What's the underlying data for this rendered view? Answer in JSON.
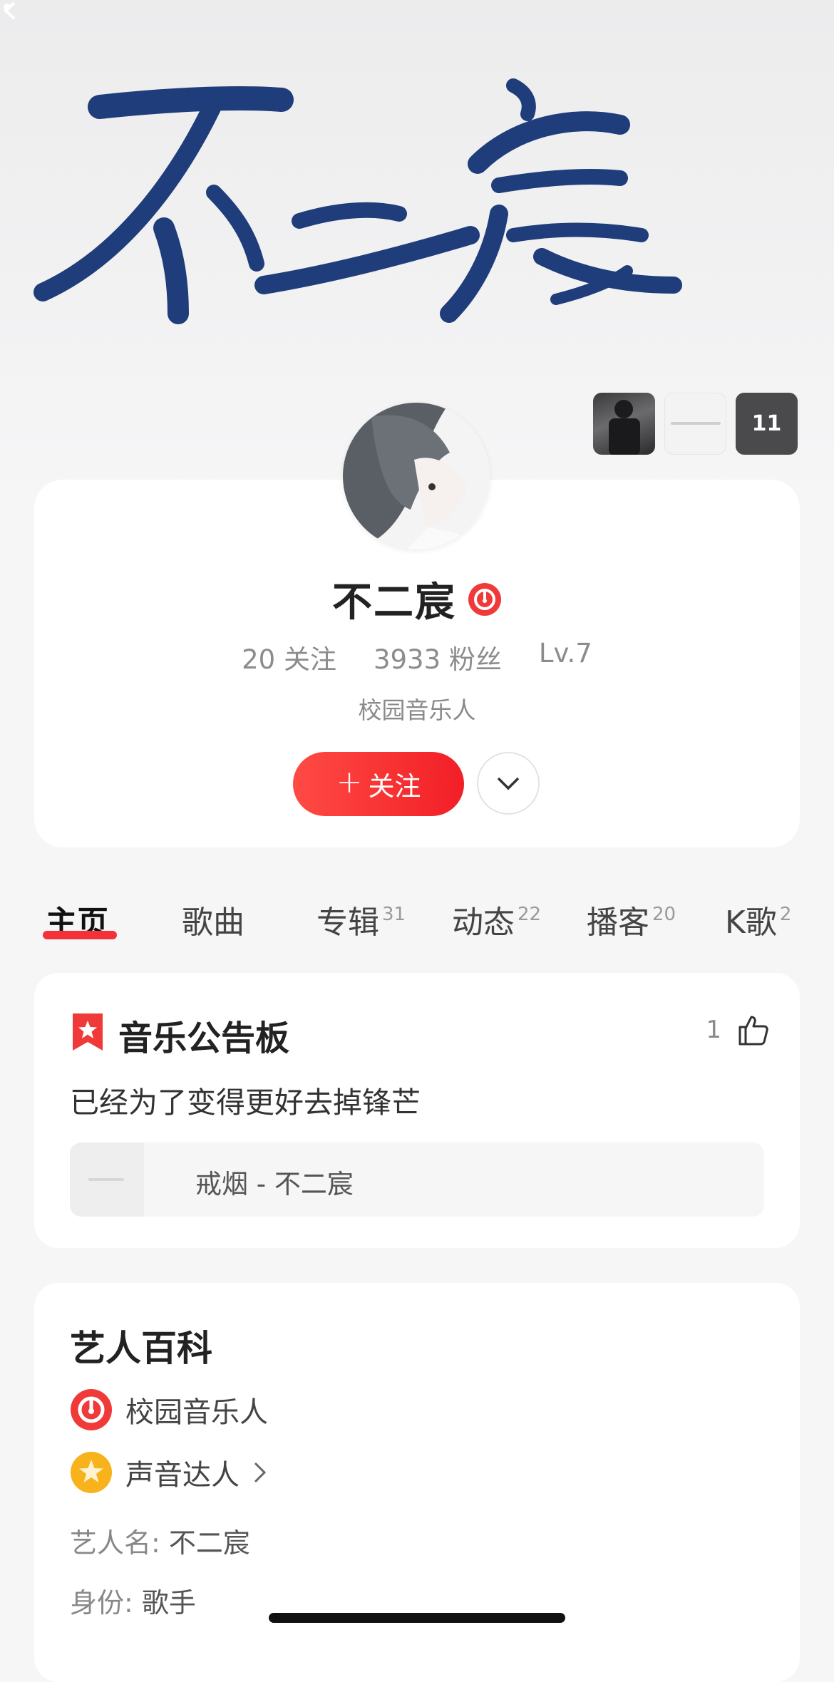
{
  "hero": {
    "calligraphy_text": "不二宸",
    "photo_count": "11"
  },
  "profile": {
    "name": "不二宸",
    "following": "20 关注",
    "fans": "3933 粉丝",
    "level": "Lv.7",
    "subtitle": "校园音乐人",
    "follow_label": "关注"
  },
  "tabs": [
    {
      "label": "主页",
      "count": ""
    },
    {
      "label": "歌曲",
      "count": ""
    },
    {
      "label": "专辑",
      "count": "31"
    },
    {
      "label": "动态",
      "count": "22"
    },
    {
      "label": "播客",
      "count": "20"
    },
    {
      "label": "K歌",
      "count": "2"
    }
  ],
  "bulletin": {
    "title": "音乐公告板",
    "likes": "1",
    "text": "已经为了变得更好去掉锋芒",
    "song": "戒烟 - 不二宸"
  },
  "wiki": {
    "title": "艺人百科",
    "badge1": "校园音乐人",
    "badge2": "声音达人",
    "field1_key": "艺人名:",
    "field1_val": "不二宸",
    "field2_key": "身份:",
    "field2_val": "歌手"
  },
  "colors": {
    "accent": "#f3313a",
    "calligraphy": "#1f3d7a"
  }
}
